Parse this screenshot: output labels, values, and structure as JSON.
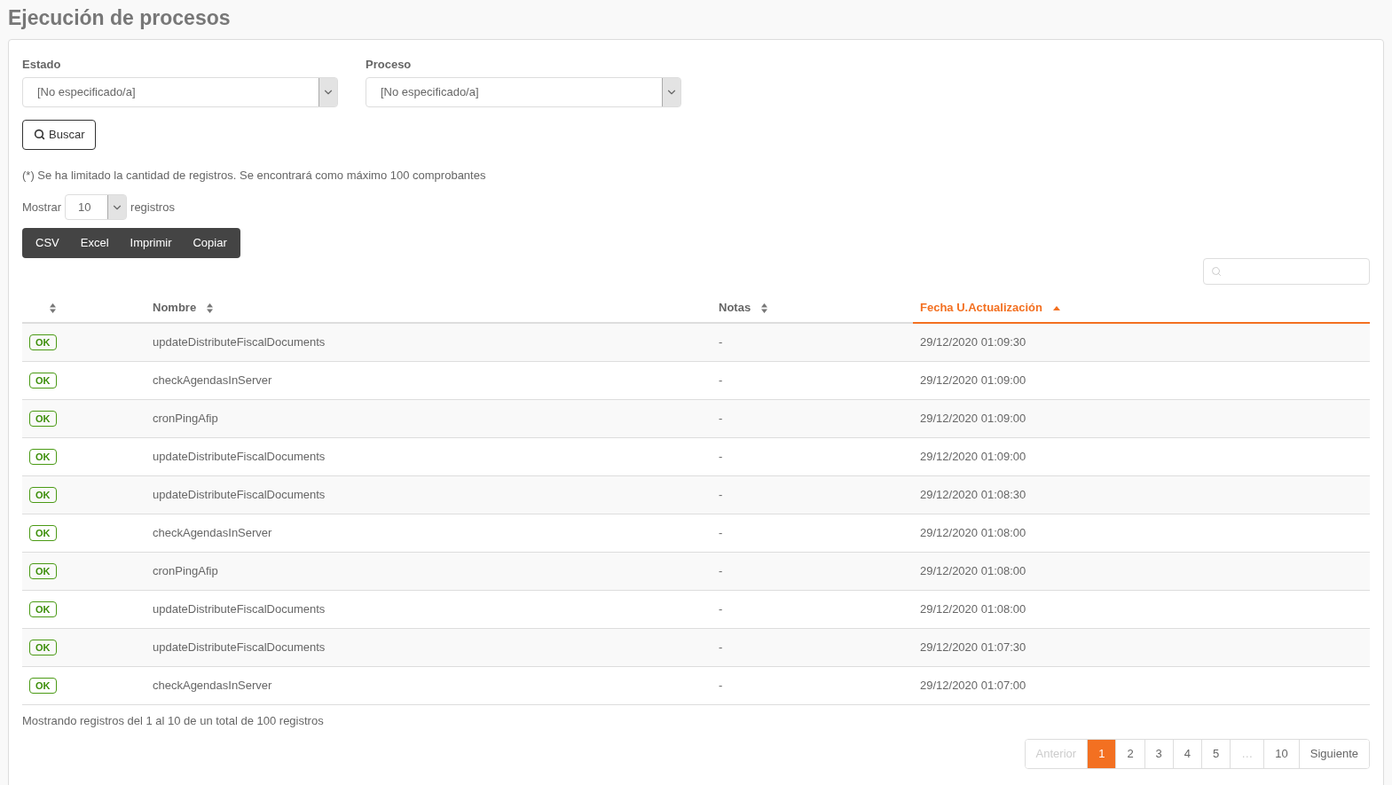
{
  "title": "Ejecución de procesos",
  "filters": [
    {
      "label": "Estado",
      "value": "[No especificado/a]"
    },
    {
      "label": "Proceso",
      "value": "[No especificado/a]"
    }
  ],
  "search_button": "Buscar",
  "notice": "(*) Se ha limitado la cantidad de registros. Se encontrará como máximo 100 comprobantes",
  "length": {
    "before": "Mostrar",
    "value": "10",
    "after": "registros"
  },
  "export_buttons": [
    "CSV",
    "Excel",
    "Imprimir",
    "Copiar"
  ],
  "table": {
    "columns": [
      {
        "sorted": false
      },
      {
        "label": "Nombre",
        "sorted": false
      },
      {
        "label": "Notas",
        "sorted": false
      },
      {
        "label": "Fecha U.Actualización",
        "sorted": true
      }
    ],
    "rows": [
      {
        "status": "OK",
        "name": "updateDistributeFiscalDocuments",
        "notes": "-",
        "date": "29/12/2020 01:09:30"
      },
      {
        "status": "OK",
        "name": "checkAgendasInServer",
        "notes": "-",
        "date": "29/12/2020 01:09:00"
      },
      {
        "status": "OK",
        "name": "cronPingAfip",
        "notes": "-",
        "date": "29/12/2020 01:09:00"
      },
      {
        "status": "OK",
        "name": "updateDistributeFiscalDocuments",
        "notes": "-",
        "date": "29/12/2020 01:09:00"
      },
      {
        "status": "OK",
        "name": "updateDistributeFiscalDocuments",
        "notes": "-",
        "date": "29/12/2020 01:08:30"
      },
      {
        "status": "OK",
        "name": "checkAgendasInServer",
        "notes": "-",
        "date": "29/12/2020 01:08:00"
      },
      {
        "status": "OK",
        "name": "cronPingAfip",
        "notes": "-",
        "date": "29/12/2020 01:08:00"
      },
      {
        "status": "OK",
        "name": "updateDistributeFiscalDocuments",
        "notes": "-",
        "date": "29/12/2020 01:08:00"
      },
      {
        "status": "OK",
        "name": "updateDistributeFiscalDocuments",
        "notes": "-",
        "date": "29/12/2020 01:07:30"
      },
      {
        "status": "OK",
        "name": "checkAgendasInServer",
        "notes": "-",
        "date": "29/12/2020 01:07:00"
      }
    ]
  },
  "info": "Mostrando registros del 1 al 10 de un total de 100 registros",
  "pagination": [
    {
      "label": "Anterior",
      "selected": false,
      "disabled": true
    },
    {
      "label": "1",
      "selected": true,
      "disabled": false
    },
    {
      "label": "2",
      "selected": false,
      "disabled": false
    },
    {
      "label": "3",
      "selected": false,
      "disabled": false
    },
    {
      "label": "4",
      "selected": false,
      "disabled": false
    },
    {
      "label": "5",
      "selected": false,
      "disabled": false
    },
    {
      "label": "…",
      "selected": false,
      "disabled": true
    },
    {
      "label": "10",
      "selected": false,
      "disabled": false
    },
    {
      "label": "Siguiente",
      "selected": false,
      "disabled": false
    }
  ]
}
